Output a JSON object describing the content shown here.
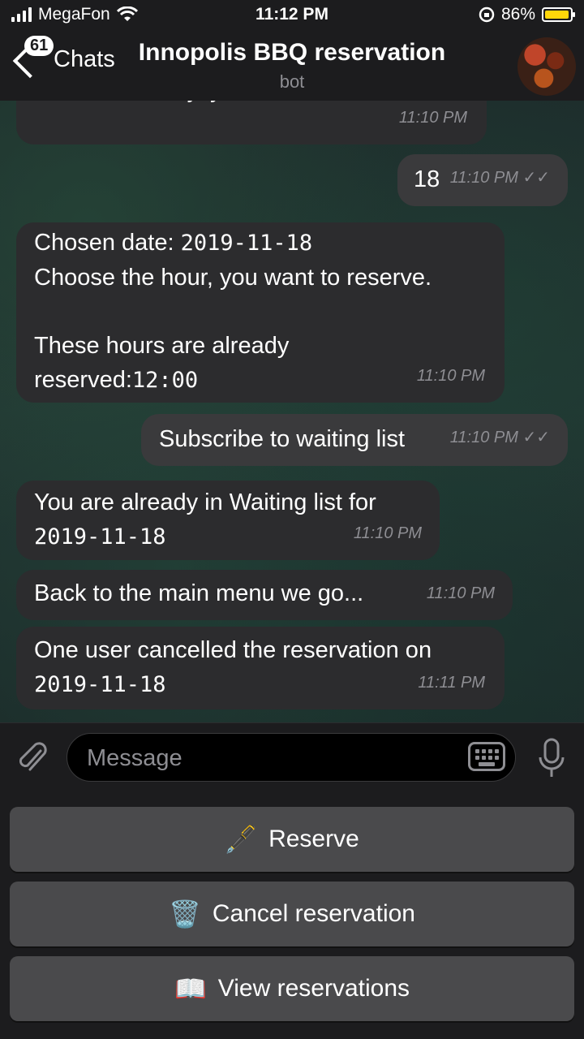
{
  "status": {
    "carrier": "MegaFon",
    "time": "11:12 PM",
    "battery": "86%",
    "battery_color": "#ffd60a"
  },
  "nav": {
    "back_label": "Chats",
    "unread_badge": "61",
    "title": "Innopolis BBQ reservation",
    "subtitle": "bot"
  },
  "messages": [
    {
      "dir": "in",
      "text": "Choose the day, you want to reserve",
      "time": "11:10 PM"
    },
    {
      "dir": "out",
      "text": "18",
      "time": "11:10 PM"
    },
    {
      "dir": "in",
      "text_a": "Chosen date: ",
      "text_b": "2019-11-18",
      "text_c": "Choose the hour, you want to reserve.",
      "text_d": "These hours are already",
      "text_e": "reserved:",
      "text_f": "12:00",
      "time": "11:10 PM"
    },
    {
      "dir": "out",
      "text": "Subscribe to waiting list",
      "time": "11:10 PM"
    },
    {
      "dir": "in",
      "text_a": "You are already in Waiting list for",
      "text_b": "2019-11-18",
      "time": "11:10 PM"
    },
    {
      "dir": "in",
      "text": "Back to the main menu we go...",
      "time": "11:10 PM"
    },
    {
      "dir": "in",
      "text_a": "One user cancelled the reservation on",
      "text_b": "2019-11-18",
      "time": "11:11 PM"
    }
  ],
  "input": {
    "placeholder": "Message"
  },
  "keyboard_buttons": [
    {
      "emoji": "🖋️",
      "label": "Reserve"
    },
    {
      "emoji": "🗑️",
      "label": "Cancel reservation"
    },
    {
      "emoji": "📖",
      "label": "View reservations"
    }
  ],
  "icons": {
    "attach": "paperclip-icon",
    "keyboard": "keyboard-icon",
    "mic": "microphone-icon",
    "wifi": "wifi-icon",
    "signal": "signal-icon",
    "battery": "battery-icon",
    "lock_rotation": "rotation-lock-icon"
  }
}
